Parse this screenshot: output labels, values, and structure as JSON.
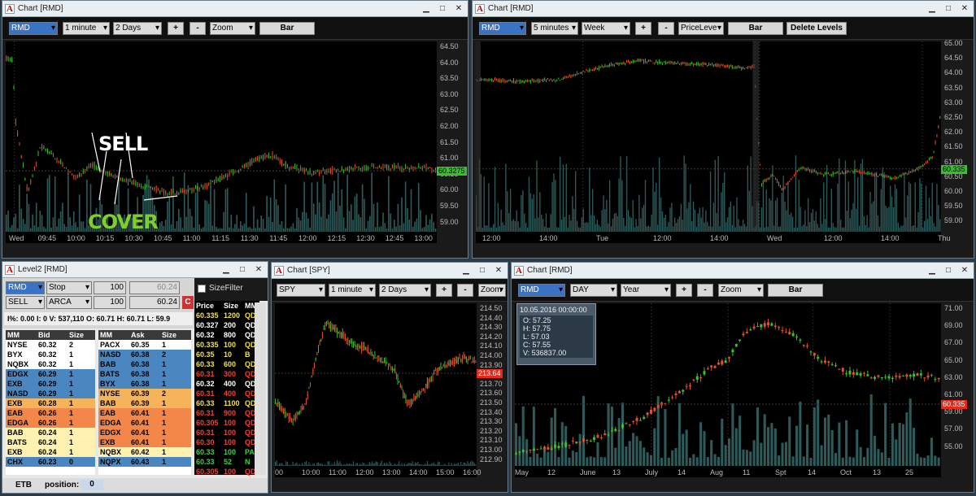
{
  "colors": {
    "up": "#3dbe2a",
    "down": "#e2512a",
    "volume": "#2f5a5a"
  },
  "win1": {
    "title": "Chart [RMD]",
    "symbol": "RMD",
    "interval": "1 minute",
    "range": "2 Days",
    "plus": "+",
    "minus": "-",
    "zoom": "Zoom",
    "type": "Bar",
    "yticks": [
      "64.50",
      "64.00",
      "63.50",
      "63.00",
      "62.50",
      "62.00",
      "61.50",
      "61.00",
      "60.50",
      "60.00",
      "59.50",
      "59.00"
    ],
    "xticks": [
      "Wed",
      "09:45",
      "10:00",
      "10:15",
      "10:30",
      "10:45",
      "11:00",
      "11:15",
      "11:30",
      "11:45",
      "12:00",
      "12:15",
      "12:30",
      "12:45",
      "13:00"
    ],
    "last": "60.3275",
    "sell_label": "SELL",
    "cover_label": "COVER"
  },
  "win2": {
    "title": "Chart [RMD]",
    "symbol": "RMD",
    "interval": "5 minutes",
    "range": "Week",
    "plus": "+",
    "minus": "-",
    "study": "PriceLeve",
    "type": "Bar",
    "delete": "Delete Levels",
    "yticks": [
      "65.00",
      "64.50",
      "64.00",
      "63.50",
      "63.00",
      "62.50",
      "62.00",
      "61.50",
      "61.00",
      "60.50",
      "60.00",
      "59.50",
      "59.00"
    ],
    "xticks": [
      "12:00",
      "14:00",
      "Tue",
      "12:00",
      "14:00",
      "Wed",
      "12:00",
      "14:00",
      "Thu"
    ],
    "last": "60.335"
  },
  "level2": {
    "title": "Level2 [RMD]",
    "symbol": "RMD",
    "order_type": "Stop",
    "qty1": "100",
    "price1": "60.24",
    "side": "SELL",
    "route": "ARCA",
    "qty2": "100",
    "price2": "60.24",
    "sizefilter": "SizeFilter",
    "stats": "I%: 0.00  I: 0  V: 537,110  O: 60.71  H: 60.71  L: 59.9",
    "bid_headers": [
      "MM",
      "Bid",
      "Size"
    ],
    "ask_headers": [
      "MM",
      "Ask",
      "Size"
    ],
    "ts_headers": [
      "Price",
      "Size",
      "MM"
    ],
    "bids": [
      [
        "NYSE",
        "60.32",
        "2"
      ],
      [
        "BYX",
        "60.32",
        "1"
      ],
      [
        "NQBX",
        "60.32",
        "1"
      ],
      [
        "EDGX",
        "60.29",
        "1"
      ],
      [
        "EXB",
        "60.29",
        "1"
      ],
      [
        "NASD",
        "60.29",
        "1"
      ],
      [
        "EXB",
        "60.28",
        "1"
      ],
      [
        "EAB",
        "60.26",
        "1"
      ],
      [
        "EDGA",
        "60.26",
        "1"
      ],
      [
        "BAB",
        "60.24",
        "1"
      ],
      [
        "BATS",
        "60.24",
        "1"
      ],
      [
        "EXB",
        "60.24",
        "1"
      ],
      [
        "CHX",
        "60.23",
        "0"
      ]
    ],
    "asks": [
      [
        "PACX",
        "60.35",
        "1"
      ],
      [
        "NASD",
        "60.38",
        "2"
      ],
      [
        "BAB",
        "60.38",
        "1"
      ],
      [
        "BATS",
        "60.38",
        "1"
      ],
      [
        "BYX",
        "60.38",
        "1"
      ],
      [
        "NYSE",
        "60.39",
        "2"
      ],
      [
        "BAB",
        "60.39",
        "1"
      ],
      [
        "EAB",
        "60.41",
        "1"
      ],
      [
        "EDGA",
        "60.41",
        "1"
      ],
      [
        "EDGX",
        "60.41",
        "1"
      ],
      [
        "EXB",
        "60.41",
        "1"
      ],
      [
        "NQBX",
        "60.42",
        "1"
      ],
      [
        "NQPX",
        "60.43",
        "1"
      ]
    ],
    "trades": [
      [
        "60.335",
        "1200",
        "QD"
      ],
      [
        "60.327",
        "200",
        "QD"
      ],
      [
        "60.32",
        "800",
        "QD"
      ],
      [
        "60.335",
        "100",
        "QD"
      ],
      [
        "60.35",
        "10",
        "B"
      ],
      [
        "60.33",
        "600",
        "QD"
      ],
      [
        "60.31",
        "300",
        "QD"
      ],
      [
        "60.32",
        "400",
        "QD"
      ],
      [
        "60.31",
        "400",
        "QD"
      ],
      [
        "60.33",
        "1100",
        "QD"
      ],
      [
        "60.31",
        "900",
        "QD"
      ],
      [
        "60.305",
        "100",
        "QD"
      ],
      [
        "60.31",
        "100",
        "QD"
      ],
      [
        "60.30",
        "100",
        "QD"
      ],
      [
        "60.33",
        "100",
        "PA"
      ],
      [
        "60.33",
        "52",
        "N"
      ],
      [
        "60.305",
        "100",
        "QD"
      ]
    ],
    "footer_label": "ETB",
    "position_label": "position:",
    "position_value": "0"
  },
  "win3": {
    "title": "Chart [SPY]",
    "symbol": "SPY",
    "interval": "1 minute",
    "range": "2 Days",
    "plus": "+",
    "minus": "-",
    "zoom": "Zoom",
    "yticks": [
      "214.50",
      "214.40",
      "214.30",
      "214.20",
      "214.10",
      "214.00",
      "213.90",
      "213.80",
      "213.70",
      "213.60",
      "213.50",
      "213.40",
      "213.30",
      "213.20",
      "213.10",
      "213.00",
      "212.90"
    ],
    "xticks": [
      "00",
      "10:00",
      "11:00",
      "12:00",
      "13:00",
      "14:00",
      "15:00",
      "16:00"
    ],
    "last": "213.64"
  },
  "win4": {
    "title": "Chart [RMD]",
    "symbol": "RMD",
    "interval": "DAY",
    "range": "Year",
    "plus": "+",
    "minus": "-",
    "zoom": "Zoom",
    "type": "Bar",
    "yticks": [
      "71.00",
      "69.00",
      "67.00",
      "65.00",
      "63.00",
      "61.00",
      "59.00",
      "57.00",
      "55.00"
    ],
    "xticks": [
      "May",
      "12",
      "June",
      "13",
      "July",
      "14",
      "Aug",
      "11",
      "Spt",
      "14",
      "Oct",
      "13",
      "25"
    ],
    "last": "60.335",
    "tooltip": {
      "date": "10.05.2016 00:00:00",
      "o": "O: 57.25",
      "h": "H: 57.75",
      "l": "L: 57.03",
      "c": "C: 57.55",
      "v": "V: 536837.00"
    }
  }
}
